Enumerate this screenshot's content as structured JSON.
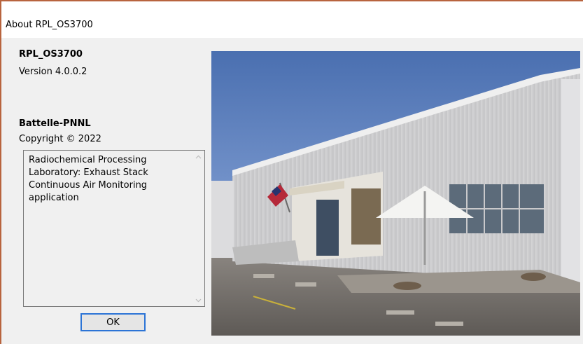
{
  "window": {
    "title": "About RPL_OS3700"
  },
  "about": {
    "product_name": "RPL_OS3700",
    "version": "Version 4.0.0.2",
    "company": "Battelle-PNNL",
    "copyright": "Copyright ©  2022",
    "description": "Radiochemical Processing Laboratory: Exhaust Stack Continuous Air Monitoring application"
  },
  "buttons": {
    "ok_label": "OK"
  },
  "icons": {
    "scroll_up": "chevron-up-icon",
    "scroll_down": "chevron-down-icon"
  },
  "colors": {
    "window_border": "#b8643e",
    "button_focus": "#2c74d6"
  }
}
